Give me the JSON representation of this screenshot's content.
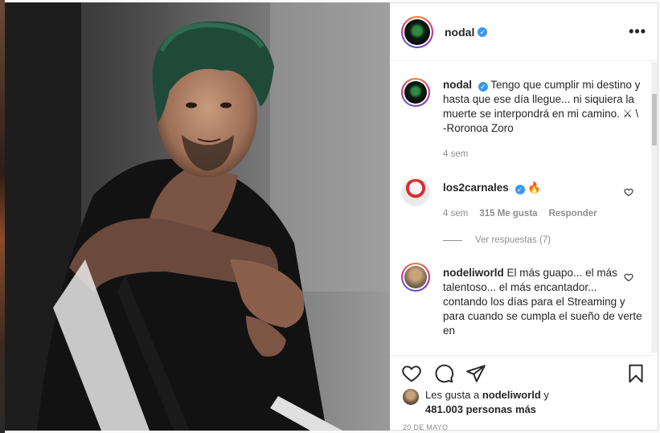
{
  "post": {
    "author": "nodal",
    "more_label": "•••"
  },
  "caption": {
    "user": "nodal",
    "text": "Tengo que cumplir mi destino y hasta que ese día llegue... ni siquiera la muerte se interpondrá en mi camino. ⚔ \\",
    "text2": "-Roronoa Zoro",
    "time": "4 sem"
  },
  "comments": [
    {
      "user": "los2carnales",
      "text": "🔥",
      "time": "4 sem",
      "likes": "315 Me gusta",
      "reply": "Responder",
      "replies_label": "Ver respuestas (7)"
    },
    {
      "user": "nodeliworld",
      "text": "El más guapo... el más talentoso... el más encantador... contando los días para el Streaming y para cuando se cumpla el sueño de verte en"
    }
  ],
  "likes": {
    "prefix": "Les gusta a ",
    "user": "nodeliworld",
    "suffix": " y",
    "count": "481.003 personas más"
  },
  "date": "20 DE MAYO",
  "icons": [
    "verified-icon",
    "more-icon",
    "heart-icon",
    "comment-icon",
    "share-icon",
    "bookmark-icon"
  ],
  "colors": {
    "verified": "#3897f0",
    "meta": "#8e8e8e",
    "text": "#262626"
  }
}
